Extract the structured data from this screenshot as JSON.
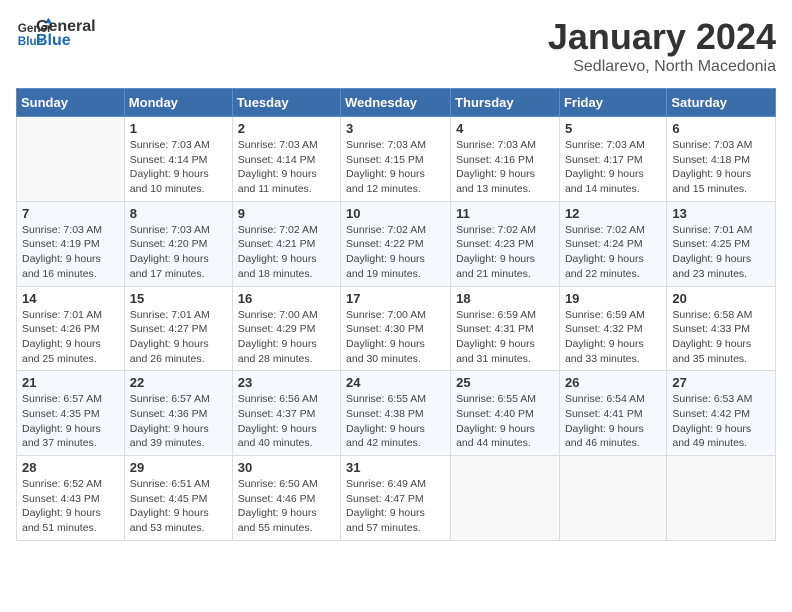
{
  "header": {
    "logo_line1": "General",
    "logo_line2": "Blue",
    "month_title": "January 2024",
    "subtitle": "Sedlarevo, North Macedonia"
  },
  "weekdays": [
    "Sunday",
    "Monday",
    "Tuesday",
    "Wednesday",
    "Thursday",
    "Friday",
    "Saturday"
  ],
  "weeks": [
    [
      {
        "day": "",
        "info": ""
      },
      {
        "day": "1",
        "info": "Sunrise: 7:03 AM\nSunset: 4:14 PM\nDaylight: 9 hours\nand 10 minutes."
      },
      {
        "day": "2",
        "info": "Sunrise: 7:03 AM\nSunset: 4:14 PM\nDaylight: 9 hours\nand 11 minutes."
      },
      {
        "day": "3",
        "info": "Sunrise: 7:03 AM\nSunset: 4:15 PM\nDaylight: 9 hours\nand 12 minutes."
      },
      {
        "day": "4",
        "info": "Sunrise: 7:03 AM\nSunset: 4:16 PM\nDaylight: 9 hours\nand 13 minutes."
      },
      {
        "day": "5",
        "info": "Sunrise: 7:03 AM\nSunset: 4:17 PM\nDaylight: 9 hours\nand 14 minutes."
      },
      {
        "day": "6",
        "info": "Sunrise: 7:03 AM\nSunset: 4:18 PM\nDaylight: 9 hours\nand 15 minutes."
      }
    ],
    [
      {
        "day": "7",
        "info": "Sunrise: 7:03 AM\nSunset: 4:19 PM\nDaylight: 9 hours\nand 16 minutes."
      },
      {
        "day": "8",
        "info": "Sunrise: 7:03 AM\nSunset: 4:20 PM\nDaylight: 9 hours\nand 17 minutes."
      },
      {
        "day": "9",
        "info": "Sunrise: 7:02 AM\nSunset: 4:21 PM\nDaylight: 9 hours\nand 18 minutes."
      },
      {
        "day": "10",
        "info": "Sunrise: 7:02 AM\nSunset: 4:22 PM\nDaylight: 9 hours\nand 19 minutes."
      },
      {
        "day": "11",
        "info": "Sunrise: 7:02 AM\nSunset: 4:23 PM\nDaylight: 9 hours\nand 21 minutes."
      },
      {
        "day": "12",
        "info": "Sunrise: 7:02 AM\nSunset: 4:24 PM\nDaylight: 9 hours\nand 22 minutes."
      },
      {
        "day": "13",
        "info": "Sunrise: 7:01 AM\nSunset: 4:25 PM\nDaylight: 9 hours\nand 23 minutes."
      }
    ],
    [
      {
        "day": "14",
        "info": "Sunrise: 7:01 AM\nSunset: 4:26 PM\nDaylight: 9 hours\nand 25 minutes."
      },
      {
        "day": "15",
        "info": "Sunrise: 7:01 AM\nSunset: 4:27 PM\nDaylight: 9 hours\nand 26 minutes."
      },
      {
        "day": "16",
        "info": "Sunrise: 7:00 AM\nSunset: 4:29 PM\nDaylight: 9 hours\nand 28 minutes."
      },
      {
        "day": "17",
        "info": "Sunrise: 7:00 AM\nSunset: 4:30 PM\nDaylight: 9 hours\nand 30 minutes."
      },
      {
        "day": "18",
        "info": "Sunrise: 6:59 AM\nSunset: 4:31 PM\nDaylight: 9 hours\nand 31 minutes."
      },
      {
        "day": "19",
        "info": "Sunrise: 6:59 AM\nSunset: 4:32 PM\nDaylight: 9 hours\nand 33 minutes."
      },
      {
        "day": "20",
        "info": "Sunrise: 6:58 AM\nSunset: 4:33 PM\nDaylight: 9 hours\nand 35 minutes."
      }
    ],
    [
      {
        "day": "21",
        "info": "Sunrise: 6:57 AM\nSunset: 4:35 PM\nDaylight: 9 hours\nand 37 minutes."
      },
      {
        "day": "22",
        "info": "Sunrise: 6:57 AM\nSunset: 4:36 PM\nDaylight: 9 hours\nand 39 minutes."
      },
      {
        "day": "23",
        "info": "Sunrise: 6:56 AM\nSunset: 4:37 PM\nDaylight: 9 hours\nand 40 minutes."
      },
      {
        "day": "24",
        "info": "Sunrise: 6:55 AM\nSunset: 4:38 PM\nDaylight: 9 hours\nand 42 minutes."
      },
      {
        "day": "25",
        "info": "Sunrise: 6:55 AM\nSunset: 4:40 PM\nDaylight: 9 hours\nand 44 minutes."
      },
      {
        "day": "26",
        "info": "Sunrise: 6:54 AM\nSunset: 4:41 PM\nDaylight: 9 hours\nand 46 minutes."
      },
      {
        "day": "27",
        "info": "Sunrise: 6:53 AM\nSunset: 4:42 PM\nDaylight: 9 hours\nand 49 minutes."
      }
    ],
    [
      {
        "day": "28",
        "info": "Sunrise: 6:52 AM\nSunset: 4:43 PM\nDaylight: 9 hours\nand 51 minutes."
      },
      {
        "day": "29",
        "info": "Sunrise: 6:51 AM\nSunset: 4:45 PM\nDaylight: 9 hours\nand 53 minutes."
      },
      {
        "day": "30",
        "info": "Sunrise: 6:50 AM\nSunset: 4:46 PM\nDaylight: 9 hours\nand 55 minutes."
      },
      {
        "day": "31",
        "info": "Sunrise: 6:49 AM\nSunset: 4:47 PM\nDaylight: 9 hours\nand 57 minutes."
      },
      {
        "day": "",
        "info": ""
      },
      {
        "day": "",
        "info": ""
      },
      {
        "day": "",
        "info": ""
      }
    ]
  ]
}
